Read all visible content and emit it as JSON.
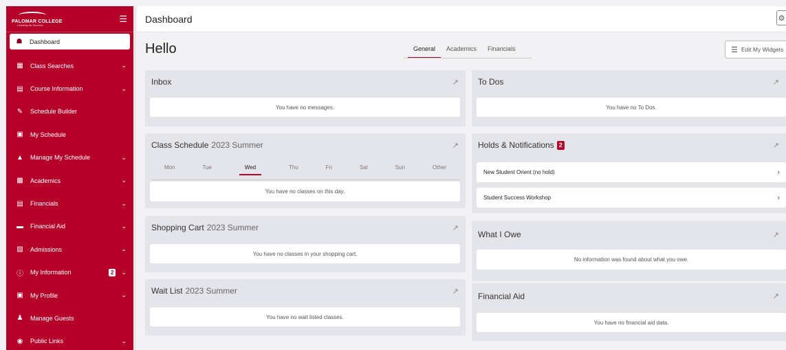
{
  "sidebar": {
    "logo_name": "PALOMAR COLLEGE",
    "logo_tagline": "Learning for Success",
    "items": [
      {
        "label": "Dashboard",
        "icon": "home-icon",
        "active": true,
        "chevron": false
      },
      {
        "label": "Class Searches",
        "icon": "table-icon",
        "chevron": true
      },
      {
        "label": "Course Information",
        "icon": "list-icon",
        "chevron": true
      },
      {
        "label": "Schedule Builder",
        "icon": "edit-icon",
        "chevron": false
      },
      {
        "label": "My Schedule",
        "icon": "calendar-icon",
        "chevron": false
      },
      {
        "label": "Manage My Schedule",
        "icon": "graduation-cap-icon",
        "chevron": true
      },
      {
        "label": "Academics",
        "icon": "academics-icon",
        "chevron": true
      },
      {
        "label": "Financials",
        "icon": "credit-card-icon",
        "chevron": true
      },
      {
        "label": "Financial Aid",
        "icon": "folder-icon",
        "chevron": true
      },
      {
        "label": "Admissions",
        "icon": "id-card-icon",
        "chevron": true
      },
      {
        "label": "My Information",
        "icon": "info-icon",
        "chevron": true,
        "badge": "2"
      },
      {
        "label": "My Profile",
        "icon": "profile-icon",
        "chevron": true
      },
      {
        "label": "Manage Guests",
        "icon": "users-icon",
        "chevron": false
      },
      {
        "label": "Public Links",
        "icon": "globe-icon",
        "chevron": true
      }
    ]
  },
  "header": {
    "title": "Dashboard"
  },
  "greeting": "Hello",
  "tabs": [
    {
      "label": "General",
      "active": true
    },
    {
      "label": "Academics",
      "active": false
    },
    {
      "label": "Financials",
      "active": false
    }
  ],
  "edit_widgets_label": "Edit My Widgets",
  "cards": {
    "inbox": {
      "title": "Inbox",
      "message": "You have no messages."
    },
    "class_schedule": {
      "title": "Class Schedule",
      "term": "2023 Summer",
      "days": [
        "Mon",
        "Tue",
        "Wed",
        "Thu",
        "Fri",
        "Sat",
        "Sun",
        "Other"
      ],
      "active_day": "Wed",
      "message": "You have no classes on this day."
    },
    "shopping_cart": {
      "title": "Shopping Cart",
      "term": "2023 Summer",
      "message": "You have no classes in your shopping cart."
    },
    "wait_list": {
      "title": "Wait List",
      "term": "2023 Summer",
      "message": "You have no wait listed classes."
    },
    "todos": {
      "title": "To Dos",
      "message": "You have no To Dos."
    },
    "holds": {
      "title": "Holds & Notifications",
      "count": "2",
      "items": [
        "New Student Orient (no hold)",
        "Student Success Workshop"
      ]
    },
    "what_i_owe": {
      "title": "What I Owe",
      "message": "No information was found about what you owe."
    },
    "financial_aid": {
      "title": "Financial Aid",
      "message": "You have no financial aid data."
    }
  },
  "colors": {
    "brand": "#b5002a",
    "card_bg": "#e4e5ea",
    "page_bg": "#f2f2f4"
  }
}
